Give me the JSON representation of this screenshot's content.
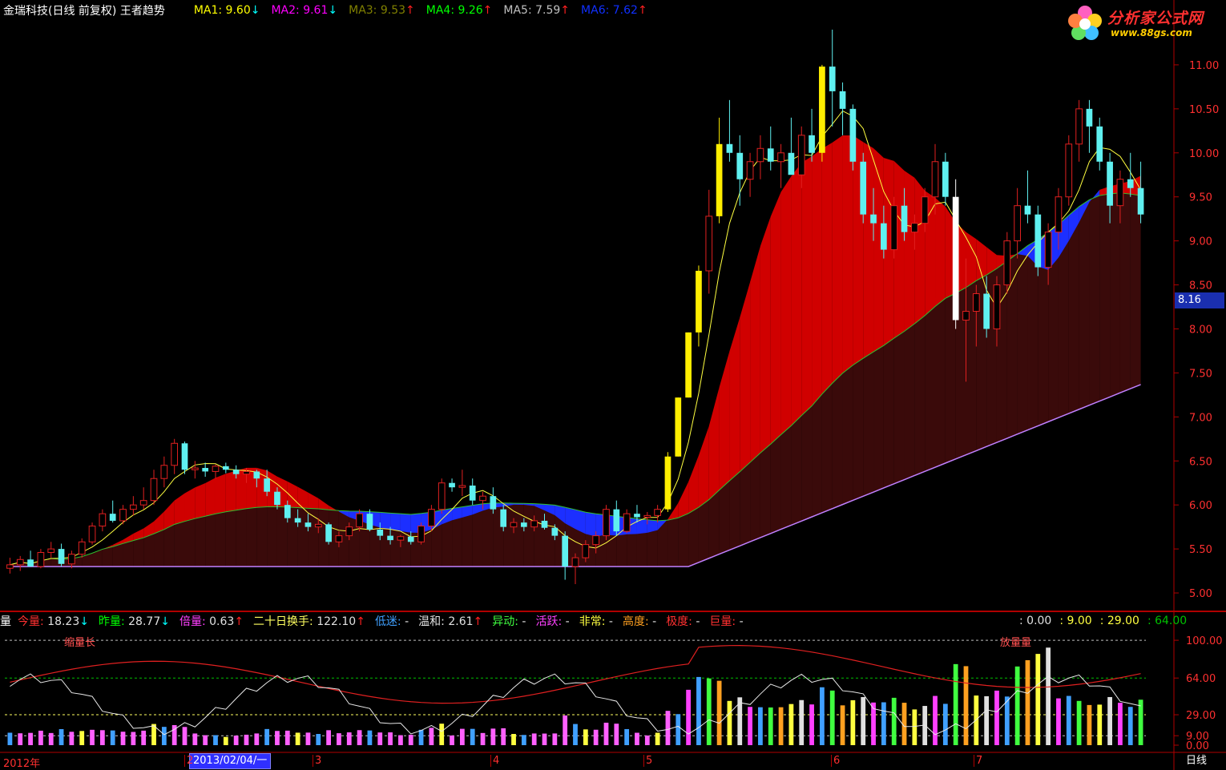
{
  "window": {
    "title": "金瑞科技(日线 前复权) 王者趋势"
  },
  "logo": {
    "brand": "分析家公式网",
    "url": "www.88gs.com"
  },
  "ma_legend": [
    {
      "label": "MA1:",
      "value": "9.60",
      "arrow": "↓",
      "color": "#ffff00"
    },
    {
      "label": "MA2:",
      "value": "9.61",
      "arrow": "↓",
      "color": "#ff00ff"
    },
    {
      "label": "MA3:",
      "value": "9.53",
      "arrow": "↑",
      "color": "#808000"
    },
    {
      "label": "MA4:",
      "value": "9.26",
      "arrow": "↑",
      "color": "#00ff00"
    },
    {
      "label": "MA5:",
      "value": "7.59",
      "arrow": "↑",
      "color": "#c0c0c0"
    },
    {
      "label": "MA6:",
      "value": "7.62",
      "arrow": "↑",
      "color": "#1030ff"
    }
  ],
  "vol_legend": {
    "title": "量",
    "items": [
      {
        "label": "今量:",
        "value": "18.23",
        "arrow": "↓",
        "color": "#ff3030"
      },
      {
        "label": "昨量:",
        "value": "28.77",
        "arrow": "↓",
        "color": "#00ff00"
      },
      {
        "label": "倍量:",
        "value": "0.63",
        "arrow": "↑",
        "color": "#ff40ff"
      },
      {
        "label": "二十日换手:",
        "value": "122.10",
        "arrow": "↑",
        "color": "#ffff60"
      },
      {
        "label": "低迷:",
        "value": "-",
        "arrow": "",
        "color": "#40a0ff"
      },
      {
        "label": "温和:",
        "value": "2.61",
        "arrow": "↑",
        "color": "#e0e0e0"
      },
      {
        "label": "异动:",
        "value": "-",
        "arrow": "",
        "color": "#40ff40"
      },
      {
        "label": "活跃:",
        "value": "-",
        "arrow": "",
        "color": "#ff40ff"
      },
      {
        "label": "非常:",
        "value": "-",
        "arrow": "",
        "color": "#ffff40"
      },
      {
        "label": "高度:",
        "value": "-",
        "arrow": "",
        "color": "#ffa020"
      },
      {
        "label": "极度:",
        "value": "-",
        "arrow": "",
        "color": "#ff3030"
      },
      {
        "label": "巨量:",
        "value": "-",
        "arrow": "",
        "color": "#ff3030"
      }
    ],
    "right": [
      {
        "value": ": 0.00",
        "color": "#e0e0e0"
      },
      {
        "value": ": 9.00",
        "color": "#ffff40"
      },
      {
        "value": ": 29.00",
        "color": "#ffff40"
      },
      {
        "value": ": 64.00",
        "color": "#00c000"
      }
    ]
  },
  "timeline": {
    "year_label": "2012年",
    "date_box": "2013/02/04/一",
    "months": [
      "2",
      "3",
      "4",
      "5",
      "6",
      "7"
    ],
    "period": "日线"
  },
  "price_tag": "8.16",
  "annotations": {
    "low_volume_note": "缩量长",
    "high_volume_note": "放量量"
  },
  "chart_data": {
    "type": "candlestick",
    "price_axis": {
      "ticks": [
        "11.00",
        "10.50",
        "10.00",
        "9.50",
        "9.00",
        "8.50",
        "8.00",
        "7.50",
        "7.00",
        "6.50",
        "6.00",
        "5.50",
        "5.00"
      ],
      "ylim": [
        4.8,
        11.5
      ]
    },
    "volume_axis": {
      "ticks": [
        "100.00",
        "64.00",
        "29.00",
        "9.00",
        "0.00"
      ],
      "ylim": [
        0,
        110
      ]
    },
    "candles_ohlc": [
      [
        5.28,
        5.4,
        5.22,
        5.32
      ],
      [
        5.32,
        5.42,
        5.25,
        5.38
      ],
      [
        5.38,
        5.48,
        5.3,
        5.3
      ],
      [
        5.3,
        5.5,
        5.28,
        5.46
      ],
      [
        5.46,
        5.58,
        5.4,
        5.5
      ],
      [
        5.5,
        5.56,
        5.3,
        5.33
      ],
      [
        5.33,
        5.48,
        5.28,
        5.44
      ],
      [
        5.44,
        5.62,
        5.4,
        5.58
      ],
      [
        5.58,
        5.8,
        5.55,
        5.76
      ],
      [
        5.76,
        5.95,
        5.7,
        5.9
      ],
      [
        5.9,
        6.05,
        5.8,
        5.82
      ],
      [
        5.82,
        6.0,
        5.78,
        5.95
      ],
      [
        5.95,
        6.1,
        5.88,
        6.0
      ],
      [
        6.0,
        6.2,
        5.95,
        6.05
      ],
      [
        6.05,
        6.4,
        6.0,
        6.3
      ],
      [
        6.3,
        6.55,
        6.2,
        6.45
      ],
      [
        6.45,
        6.75,
        6.35,
        6.7
      ],
      [
        6.7,
        6.72,
        6.35,
        6.4
      ],
      [
        6.4,
        6.5,
        6.3,
        6.42
      ],
      [
        6.42,
        6.48,
        6.32,
        6.38
      ],
      [
        6.38,
        6.46,
        6.3,
        6.44
      ],
      [
        6.44,
        6.48,
        6.36,
        6.4
      ],
      [
        6.4,
        6.45,
        6.3,
        6.35
      ],
      [
        6.35,
        6.42,
        6.25,
        6.38
      ],
      [
        6.38,
        6.4,
        6.2,
        6.3
      ],
      [
        6.3,
        6.4,
        6.1,
        6.15
      ],
      [
        6.15,
        6.2,
        5.95,
        6.0
      ],
      [
        6.0,
        6.05,
        5.8,
        5.85
      ],
      [
        5.85,
        5.95,
        5.75,
        5.8
      ],
      [
        5.8,
        5.9,
        5.7,
        5.75
      ],
      [
        5.75,
        5.85,
        5.68,
        5.78
      ],
      [
        5.78,
        5.8,
        5.55,
        5.58
      ],
      [
        5.58,
        5.7,
        5.52,
        5.65
      ],
      [
        5.65,
        5.8,
        5.6,
        5.75
      ],
      [
        5.75,
        5.95,
        5.7,
        5.9
      ],
      [
        5.9,
        5.95,
        5.7,
        5.72
      ],
      [
        5.72,
        5.8,
        5.6,
        5.65
      ],
      [
        5.65,
        5.75,
        5.55,
        5.6
      ],
      [
        5.6,
        5.66,
        5.52,
        5.64
      ],
      [
        5.64,
        5.7,
        5.55,
        5.58
      ],
      [
        5.58,
        5.8,
        5.55,
        5.76
      ],
      [
        5.76,
        6.0,
        5.7,
        5.95
      ],
      [
        5.95,
        6.3,
        5.9,
        6.25
      ],
      [
        6.25,
        6.3,
        6.15,
        6.2
      ],
      [
        6.2,
        6.4,
        6.1,
        6.22
      ],
      [
        6.22,
        6.3,
        6.0,
        6.05
      ],
      [
        6.05,
        6.15,
        5.95,
        6.1
      ],
      [
        6.1,
        6.2,
        5.9,
        5.95
      ],
      [
        5.95,
        6.0,
        5.7,
        5.75
      ],
      [
        5.75,
        5.85,
        5.68,
        5.8
      ],
      [
        5.8,
        5.85,
        5.7,
        5.75
      ],
      [
        5.75,
        5.88,
        5.7,
        5.82
      ],
      [
        5.82,
        5.9,
        5.72,
        5.74
      ],
      [
        5.74,
        5.78,
        5.6,
        5.65
      ],
      [
        5.65,
        5.7,
        5.15,
        5.3
      ],
      [
        5.3,
        5.45,
        5.1,
        5.4
      ],
      [
        5.4,
        5.6,
        5.35,
        5.55
      ],
      [
        5.55,
        5.7,
        5.45,
        5.65
      ],
      [
        5.65,
        6.0,
        5.6,
        5.95
      ],
      [
        5.95,
        6.05,
        5.65,
        5.7
      ],
      [
        5.7,
        5.95,
        5.68,
        5.9
      ],
      [
        5.9,
        6.0,
        5.8,
        5.86
      ],
      [
        5.86,
        5.92,
        5.78,
        5.88
      ],
      [
        5.88,
        6.0,
        5.8,
        5.95
      ],
      [
        5.95,
        6.6,
        5.92,
        6.55
      ],
      [
        6.55,
        7.22,
        6.55,
        7.22
      ],
      [
        7.22,
        7.96,
        7.22,
        7.96
      ],
      [
        7.96,
        8.72,
        7.8,
        8.66
      ],
      [
        8.66,
        9.58,
        8.4,
        9.28
      ],
      [
        9.28,
        10.4,
        9.2,
        10.1
      ],
      [
        10.1,
        10.6,
        9.9,
        10.0
      ],
      [
        10.0,
        10.2,
        9.4,
        9.7
      ],
      [
        9.7,
        10.0,
        9.5,
        9.9
      ],
      [
        9.9,
        10.2,
        9.7,
        10.05
      ],
      [
        10.05,
        10.3,
        9.8,
        9.9
      ],
      [
        9.9,
        10.1,
        9.6,
        10.0
      ],
      [
        10.0,
        10.4,
        9.8,
        9.75
      ],
      [
        9.75,
        10.3,
        9.6,
        10.2
      ],
      [
        10.2,
        10.5,
        9.9,
        10.0
      ],
      [
        10.0,
        11.0,
        9.9,
        10.98
      ],
      [
        10.98,
        11.4,
        10.3,
        10.7
      ],
      [
        10.7,
        10.8,
        10.2,
        10.5
      ],
      [
        10.5,
        10.55,
        9.8,
        9.9
      ],
      [
        9.9,
        10.0,
        9.2,
        9.3
      ],
      [
        9.3,
        9.6,
        9.0,
        9.2
      ],
      [
        9.2,
        9.4,
        8.8,
        8.9
      ],
      [
        8.9,
        9.5,
        8.8,
        9.4
      ],
      [
        9.4,
        9.6,
        9.0,
        9.1
      ],
      [
        9.1,
        9.3,
        8.9,
        9.2
      ],
      [
        9.2,
        9.6,
        9.1,
        9.5
      ],
      [
        9.5,
        10.1,
        9.3,
        9.9
      ],
      [
        9.9,
        10.0,
        9.4,
        9.5
      ],
      [
        9.5,
        9.7,
        8.0,
        8.1
      ],
      [
        8.1,
        8.8,
        7.4,
        8.2
      ],
      [
        8.2,
        8.5,
        7.8,
        8.4
      ],
      [
        8.4,
        8.6,
        7.9,
        8.0
      ],
      [
        8.0,
        8.6,
        7.8,
        8.5
      ],
      [
        8.5,
        9.1,
        8.4,
        9.0
      ],
      [
        9.0,
        9.6,
        8.8,
        9.4
      ],
      [
        9.4,
        9.8,
        9.2,
        9.3
      ],
      [
        9.3,
        9.4,
        8.6,
        8.7
      ],
      [
        8.7,
        9.2,
        8.5,
        9.1
      ],
      [
        9.1,
        9.6,
        8.9,
        9.5
      ],
      [
        9.5,
        10.2,
        9.4,
        10.1
      ],
      [
        10.1,
        10.6,
        9.9,
        10.5
      ],
      [
        10.5,
        10.6,
        10.0,
        10.3
      ],
      [
        10.3,
        10.4,
        9.8,
        9.9
      ],
      [
        9.9,
        10.0,
        9.2,
        9.4
      ],
      [
        9.4,
        9.8,
        9.2,
        9.7
      ],
      [
        9.7,
        10.0,
        9.5,
        9.6
      ],
      [
        9.6,
        9.9,
        9.2,
        9.3
      ]
    ]
  }
}
